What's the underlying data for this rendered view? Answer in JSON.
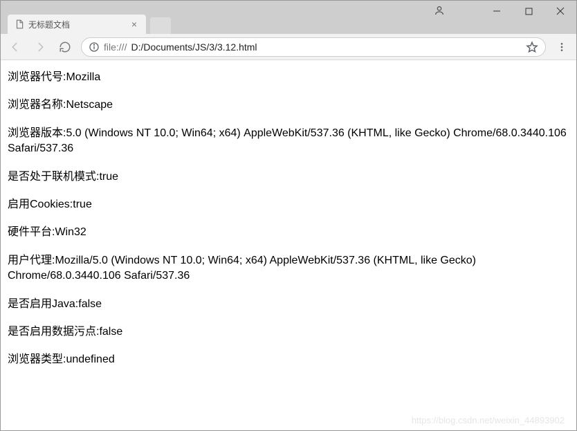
{
  "window": {
    "tab_title": "无标题文档"
  },
  "toolbar": {
    "url_prefix": "file:///",
    "url_path": "D:/Documents/JS/3/3.12.html"
  },
  "content": {
    "lines": [
      {
        "label": "浏览器代号:",
        "value": "Mozilla"
      },
      {
        "label": "浏览器名称:",
        "value": "Netscape"
      },
      {
        "label": "浏览器版本:",
        "value": "5.0 (Windows NT 10.0; Win64; x64) AppleWebKit/537.36 (KHTML, like Gecko) Chrome/68.0.3440.106 Safari/537.36"
      },
      {
        "label": "是否处于联机模式:",
        "value": "true"
      },
      {
        "label": "启用Cookies:",
        "value": "true"
      },
      {
        "label": "硬件平台:",
        "value": "Win32"
      },
      {
        "label": "用户代理:",
        "value": "Mozilla/5.0 (Windows NT 10.0; Win64; x64) AppleWebKit/537.36 (KHTML, like Gecko) Chrome/68.0.3440.106 Safari/537.36"
      },
      {
        "label": "是否启用Java:",
        "value": "false"
      },
      {
        "label": "是否启用数据污点:",
        "value": "false"
      },
      {
        "label": "浏览器类型:",
        "value": "undefined"
      }
    ]
  },
  "watermark": "https://blog.csdn.net/weixin_44893902"
}
